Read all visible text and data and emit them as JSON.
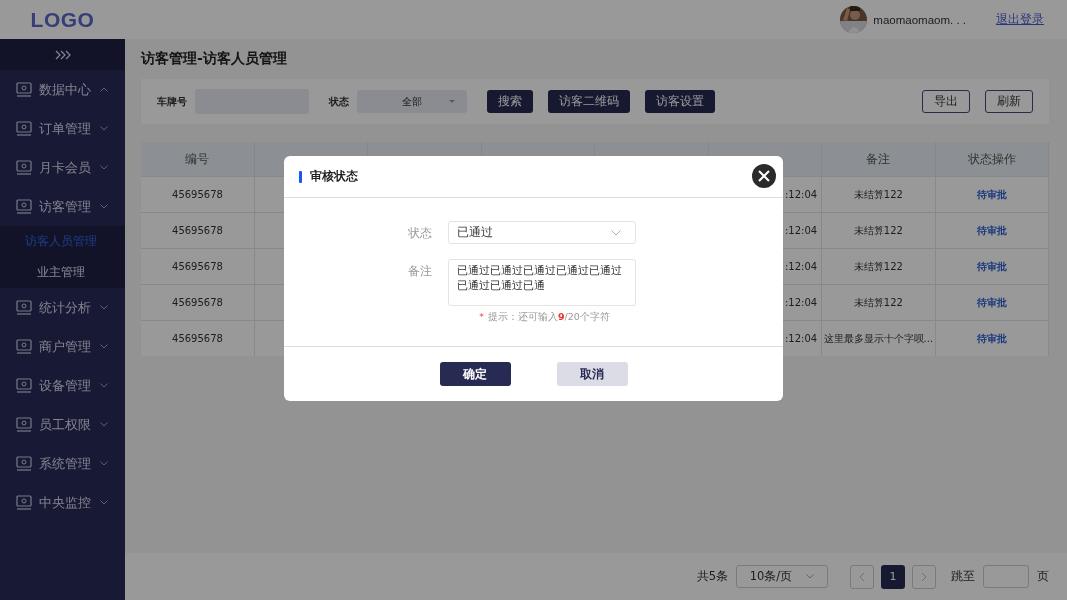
{
  "header": {
    "logo": "LOGO",
    "user_name": "maomaomaom. . .",
    "logout": "退出登录"
  },
  "sidebar": {
    "items": [
      {
        "label": "数据中心",
        "expanded": true
      },
      {
        "label": "订单管理",
        "expanded": false
      },
      {
        "label": "月卡会员",
        "expanded": false
      },
      {
        "label": "访客管理",
        "expanded": false,
        "children": [
          {
            "label": "访客人员管理",
            "selected": true
          },
          {
            "label": "业主管理",
            "selected": false
          }
        ]
      },
      {
        "label": "统计分析",
        "expanded": false
      },
      {
        "label": "商户管理",
        "expanded": false
      },
      {
        "label": "设备管理",
        "expanded": false
      },
      {
        "label": "员工权限",
        "expanded": false
      },
      {
        "label": "系统管理",
        "expanded": false
      },
      {
        "label": "中央监控",
        "expanded": false
      }
    ]
  },
  "page_title": "访客管理-访客人员管理",
  "filter": {
    "plate_label": "车牌号",
    "status_label": "状态",
    "status_value": "全部",
    "buttons": [
      "搜索",
      "访客二维码",
      "访客设置"
    ],
    "right_buttons": [
      "导出",
      "刷新"
    ]
  },
  "table": {
    "columns": [
      "编号",
      "备注",
      "状态操作"
    ],
    "rows": [
      {
        "id": "45695678",
        "end_time": ":12:04",
        "note": "未结算122",
        "action": "待审批"
      },
      {
        "id": "45695678",
        "end_time": ":12:04",
        "note": "未结算122",
        "action": "待审批"
      },
      {
        "id": "45695678",
        "end_time": ":12:04",
        "note": "未结算122",
        "action": "待审批"
      },
      {
        "id": "45695678",
        "end_time": ":12:04",
        "note": "未结算122",
        "action": "待审批"
      },
      {
        "id": "45695678",
        "end_time": ":12:04",
        "note": "这里最多显示十个字呗...",
        "action": "待审批"
      }
    ]
  },
  "pagination": {
    "total": "共5条",
    "page_size": "10条/页",
    "pages": [
      {
        "label": "1",
        "selected": true
      }
    ],
    "jump_label": "跳至",
    "page_unit": "页"
  },
  "dialog": {
    "title": "审核状态",
    "status_label": "状态",
    "status_value": "已通过",
    "note_label": "备注",
    "note_value": "已通过已通过已通过已通过已通过已通过已通过已通",
    "hint_mark": "*",
    "hint_before": "提示：还可输入",
    "hint_count": "9",
    "hint_after": "/20个字符",
    "confirm": "确定",
    "cancel": "取消"
  }
}
